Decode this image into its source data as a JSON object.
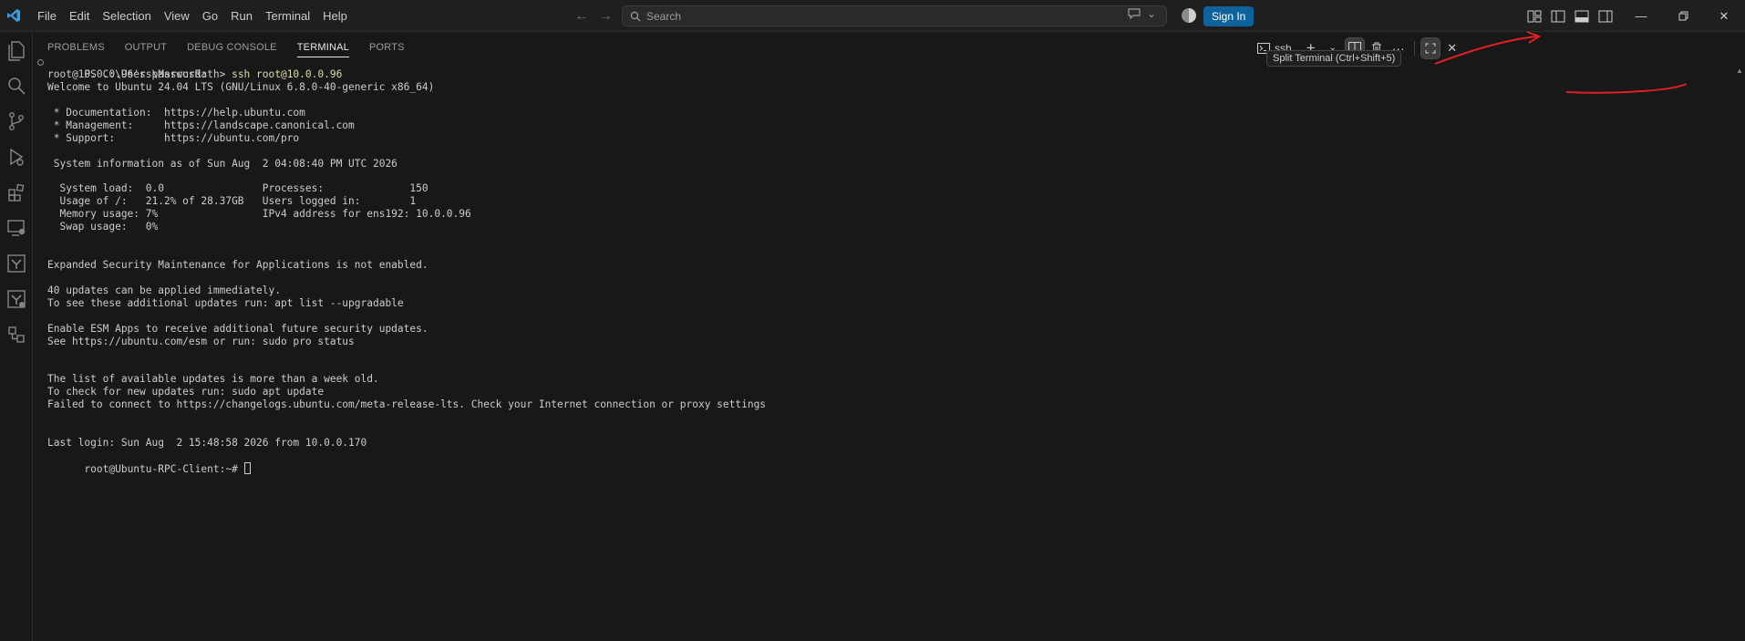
{
  "titlebar": {
    "menu": [
      "File",
      "Edit",
      "Selection",
      "View",
      "Go",
      "Run",
      "Terminal",
      "Help"
    ],
    "search_placeholder": "Search",
    "sign_in": "Sign In"
  },
  "panel": {
    "tabs": [
      "PROBLEMS",
      "OUTPUT",
      "DEBUG CONSOLE",
      "TERMINAL",
      "PORTS"
    ],
    "active_tab": "TERMINAL",
    "terminal_profile": "ssh",
    "tooltip": "Split Terminal (Ctrl+Shift+5)"
  },
  "terminal": {
    "prompt_ps": "PS C:\\Users\\MarcusRath> ",
    "command": "ssh root@10.0.0.96",
    "lines": [
      "root@10.0.0.96's password:",
      "Welcome to Ubuntu 24.04 LTS (GNU/Linux 6.8.0-40-generic x86_64)",
      "",
      " * Documentation:  https://help.ubuntu.com",
      " * Management:     https://landscape.canonical.com",
      " * Support:        https://ubuntu.com/pro",
      "",
      " System information as of Sun Aug  2 04:08:40 PM UTC 2026",
      "",
      "  System load:  0.0                Processes:              150",
      "  Usage of /:   21.2% of 28.37GB   Users logged in:        1",
      "  Memory usage: 7%                 IPv4 address for ens192: 10.0.0.96",
      "  Swap usage:   0%",
      "",
      "",
      "Expanded Security Maintenance for Applications is not enabled.",
      "",
      "40 updates can be applied immediately.",
      "To see these additional updates run: apt list --upgradable",
      "",
      "Enable ESM Apps to receive additional future security updates.",
      "See https://ubuntu.com/esm or run: sudo pro status",
      "",
      "",
      "The list of available updates is more than a week old.",
      "To check for new updates run: sudo apt update",
      "Failed to connect to https://changelogs.ubuntu.com/meta-release-lts. Check your Internet connection or proxy settings",
      "",
      "",
      "Last login: Sun Aug  2 15:48:58 2026 from 10.0.0.170"
    ],
    "final_prompt": "root@Ubuntu-RPC-Client:~# "
  },
  "colors": {
    "background": "#181818",
    "accent": "#0e639c",
    "annotation": "#e02020",
    "command": "#dcdcaa"
  },
  "icons": {
    "activitybar": [
      "files-icon",
      "search-icon",
      "source-control-icon",
      "run-debug-icon",
      "extensions-icon",
      "remote-explorer-icon",
      "azure-icon",
      "azure-devops-icon",
      "containers-icon"
    ]
  }
}
